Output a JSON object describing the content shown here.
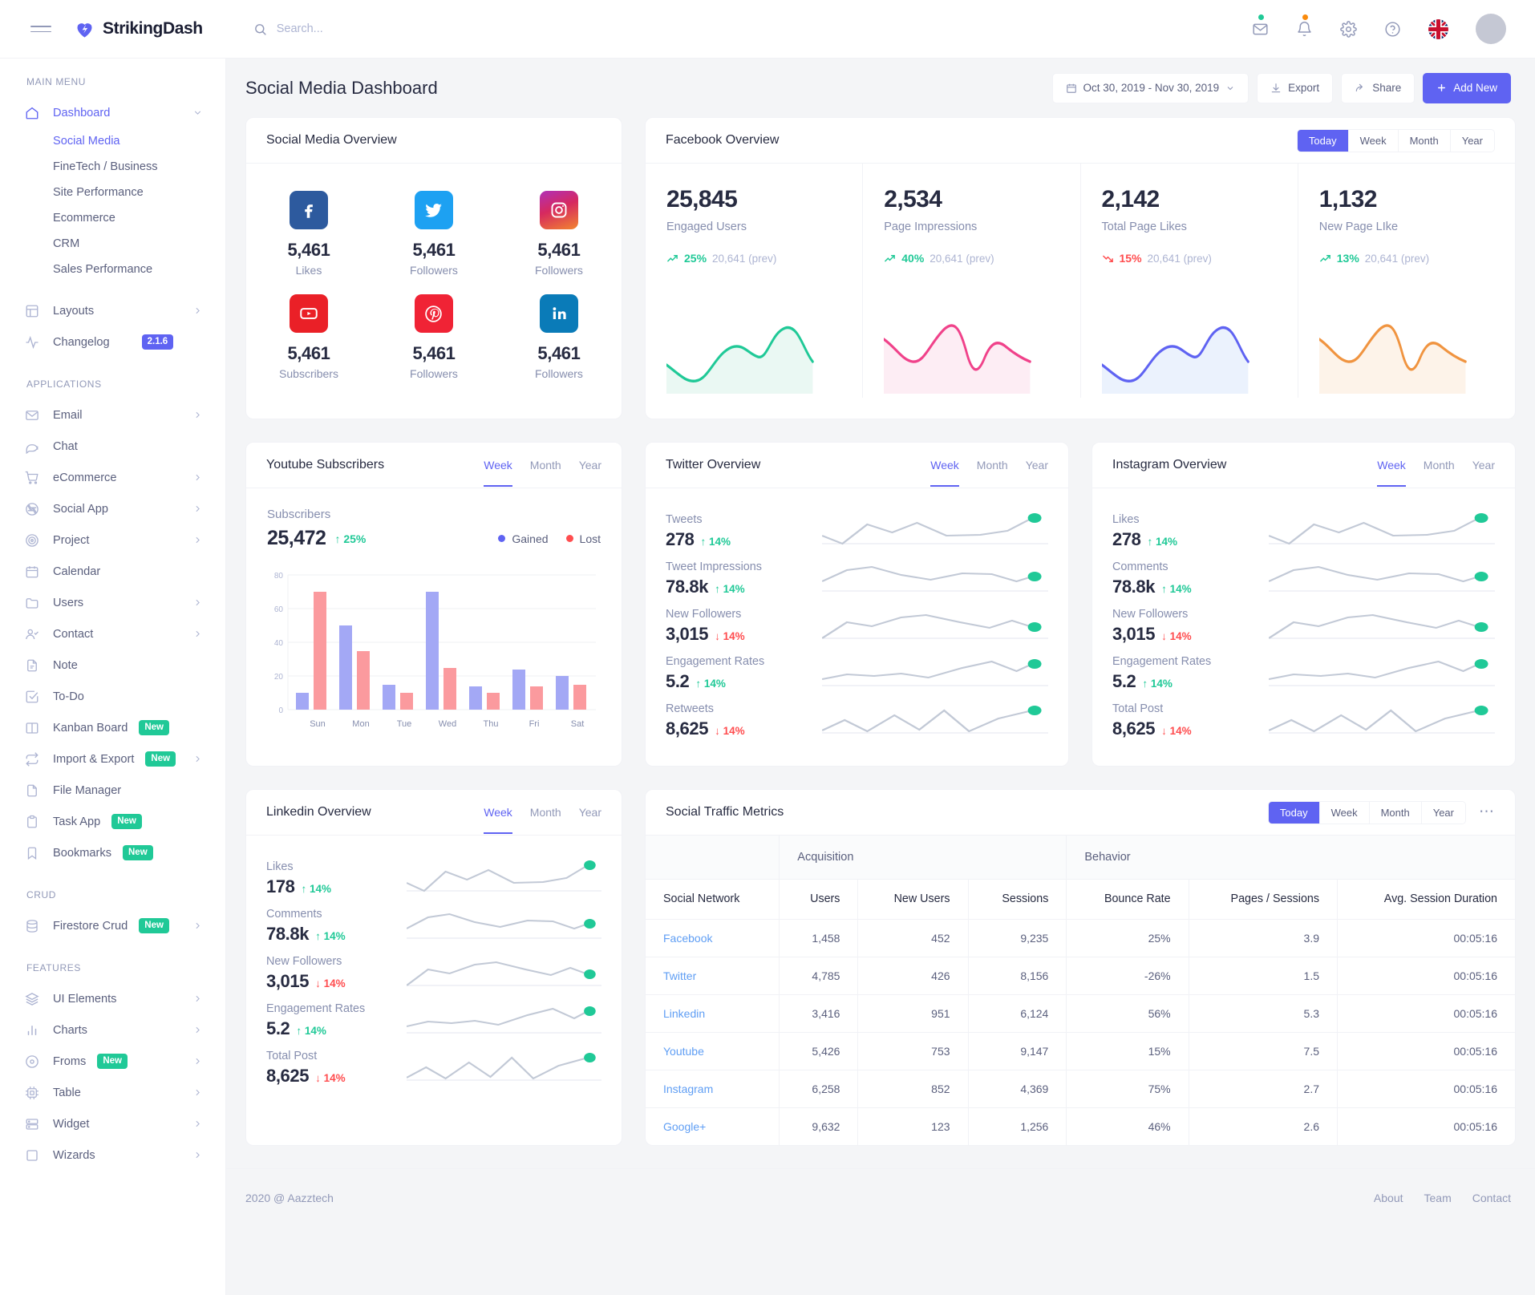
{
  "topbar": {
    "brand": "StrikingDash",
    "search_placeholder": "Search...",
    "icons": [
      "menu-icon",
      "mail-icon",
      "bell-icon",
      "gear-icon",
      "help-icon",
      "flag-uk-icon",
      "avatar"
    ]
  },
  "sidebar": {
    "groups": [
      {
        "label": "MAIN MENU",
        "items": [
          {
            "label": "Dashboard",
            "icon": "home-icon",
            "active": true,
            "caret": "down",
            "children": [
              {
                "label": "Social Media",
                "active": true
              },
              {
                "label": "FineTech / Business",
                "active": false
              },
              {
                "label": "Site Performance",
                "active": false
              },
              {
                "label": "Ecommerce",
                "active": false
              },
              {
                "label": "CRM",
                "active": false
              },
              {
                "label": "Sales Performance",
                "active": false
              }
            ]
          },
          {
            "label": "Layouts",
            "icon": "layout-icon",
            "caret": "right"
          },
          {
            "label": "Changelog",
            "icon": "activity-icon",
            "version": "2.1.6"
          }
        ]
      },
      {
        "label": "APPLICATIONS",
        "items": [
          {
            "label": "Email",
            "icon": "mail-icon",
            "caret": "right"
          },
          {
            "label": "Chat",
            "icon": "chat-icon"
          },
          {
            "label": "eCommerce",
            "icon": "cart-icon",
            "caret": "right"
          },
          {
            "label": "Social App",
            "icon": "aperture-icon",
            "caret": "right"
          },
          {
            "label": "Project",
            "icon": "target-icon",
            "caret": "right"
          },
          {
            "label": "Calendar",
            "icon": "calendar-icon"
          },
          {
            "label": "Users",
            "icon": "folder-icon",
            "caret": "right"
          },
          {
            "label": "Contact",
            "icon": "user-check-icon",
            "caret": "right"
          },
          {
            "label": "Note",
            "icon": "file-text-icon"
          },
          {
            "label": "To-Do",
            "icon": "check-square-icon"
          },
          {
            "label": "Kanban Board",
            "icon": "columns-icon",
            "badge": "New"
          },
          {
            "label": "Import & Export",
            "icon": "repeat-icon",
            "badge": "New",
            "caret": "right"
          },
          {
            "label": "File Manager",
            "icon": "file-icon"
          },
          {
            "label": "Task App",
            "icon": "clipboard-icon",
            "badge": "New"
          },
          {
            "label": "Bookmarks",
            "icon": "bookmark-icon",
            "badge": "New"
          }
        ]
      },
      {
        "label": "CRUD",
        "items": [
          {
            "label": "Firestore Crud",
            "icon": "database-icon",
            "badge": "New",
            "caret": "right"
          }
        ]
      },
      {
        "label": "FEATURES",
        "items": [
          {
            "label": "UI Elements",
            "icon": "layers-icon",
            "caret": "right"
          },
          {
            "label": "Charts",
            "icon": "bar-chart-icon",
            "caret": "right"
          },
          {
            "label": "Froms",
            "icon": "disc-icon",
            "badge": "New",
            "caret": "right"
          },
          {
            "label": "Table",
            "icon": "cpu-icon",
            "caret": "right"
          },
          {
            "label": "Widget",
            "icon": "server-icon",
            "caret": "right"
          },
          {
            "label": "Wizards",
            "icon": "square-icon",
            "caret": "right"
          }
        ]
      }
    ]
  },
  "page": {
    "title": "Social Media Dashboard",
    "date_range": "Oct 30, 2019 - Nov 30, 2019",
    "export_label": "Export",
    "share_label": "Share",
    "add_new_label": "Add New"
  },
  "social_overview": {
    "title": "Social Media Overview",
    "items": [
      {
        "network": "facebook",
        "value": "5,461",
        "label": "Likes"
      },
      {
        "network": "twitter",
        "value": "5,461",
        "label": "Followers"
      },
      {
        "network": "instagram",
        "value": "5,461",
        "label": "Followers"
      },
      {
        "network": "youtube",
        "value": "5,461",
        "label": "Subscribers"
      },
      {
        "network": "pinterest",
        "value": "5,461",
        "label": "Followers"
      },
      {
        "network": "linkedin",
        "value": "5,461",
        "label": "Followers"
      }
    ]
  },
  "facebook_overview": {
    "title": "Facebook Overview",
    "tabs": [
      "Today",
      "Week",
      "Month",
      "Year"
    ],
    "active_tab": "Today",
    "stats": [
      {
        "value": "25,845",
        "label": "Engaged Users",
        "pct": "25%",
        "dir": "up",
        "prev": "20,641 (prev)",
        "color": "#20c997"
      },
      {
        "value": "2,534",
        "label": "Page Impressions",
        "pct": "40%",
        "dir": "up",
        "prev": "20,641 (prev)",
        "color": "#f0428a"
      },
      {
        "value": "2,142",
        "label": "Total Page Likes",
        "pct": "15%",
        "dir": "down",
        "prev": "20,641 (prev)",
        "color": "#5f63f2"
      },
      {
        "value": "1,132",
        "label": "New Page LIke",
        "pct": "13%",
        "dir": "up",
        "prev": "20,641 (prev)",
        "color": "#f09440"
      }
    ]
  },
  "youtube": {
    "title": "Youtube Subscribers",
    "tabs": [
      "Week",
      "Month",
      "Year"
    ],
    "active_tab": "Week",
    "sub_label": "Subscribers",
    "sub_value": "25,472",
    "sub_delta": "25%",
    "legend": [
      {
        "label": "Gained",
        "color": "#5f63f2"
      },
      {
        "label": "Lost",
        "color": "#ff4d4f"
      }
    ]
  },
  "chart_data": {
    "type": "bar",
    "title": "Youtube Subscribers",
    "categories": [
      "Sun",
      "Mon",
      "Tue",
      "Wed",
      "Thu",
      "Fri",
      "Sat"
    ],
    "series": [
      {
        "name": "Gained",
        "color": "#a3a8f5",
        "values": [
          10,
          50,
          15,
          70,
          14,
          24,
          20
        ]
      },
      {
        "name": "Lost",
        "color": "#fb9a9e",
        "values": [
          70,
          35,
          10,
          25,
          10,
          14,
          15
        ]
      }
    ],
    "xlabel": "",
    "ylabel": "",
    "ylim": [
      0,
      80
    ],
    "yticks": [
      "0",
      "20",
      "40",
      "60",
      "80"
    ],
    "grid": true,
    "legend_position": "top-right"
  },
  "twitter": {
    "title": "Twitter Overview",
    "tabs": [
      "Week",
      "Month",
      "Year"
    ],
    "active_tab": "Week",
    "metrics": [
      {
        "label": "Tweets",
        "value": "278",
        "pct": "14%",
        "dir": "up"
      },
      {
        "label": "Tweet Impressions",
        "value": "78.8k",
        "pct": "14%",
        "dir": "up"
      },
      {
        "label": "New Followers",
        "value": "3,015",
        "pct": "14%",
        "dir": "down"
      },
      {
        "label": "Engagement Rates",
        "value": "5.2",
        "pct": "14%",
        "dir": "up"
      },
      {
        "label": "Retweets",
        "value": "8,625",
        "pct": "14%",
        "dir": "down"
      }
    ]
  },
  "instagram": {
    "title": "Instagram Overview",
    "tabs": [
      "Week",
      "Month",
      "Year"
    ],
    "active_tab": "Week",
    "metrics": [
      {
        "label": "Likes",
        "value": "278",
        "pct": "14%",
        "dir": "up"
      },
      {
        "label": "Comments",
        "value": "78.8k",
        "pct": "14%",
        "dir": "up"
      },
      {
        "label": "New Followers",
        "value": "3,015",
        "pct": "14%",
        "dir": "down"
      },
      {
        "label": "Engagement Rates",
        "value": "5.2",
        "pct": "14%",
        "dir": "up"
      },
      {
        "label": "Total Post",
        "value": "8,625",
        "pct": "14%",
        "dir": "down"
      }
    ]
  },
  "linkedin": {
    "title": "Linkedin Overview",
    "tabs": [
      "Week",
      "Month",
      "Year"
    ],
    "active_tab": "Week",
    "metrics": [
      {
        "label": "Likes",
        "value": "178",
        "pct": "14%",
        "dir": "up"
      },
      {
        "label": "Comments",
        "value": "78.8k",
        "pct": "14%",
        "dir": "up"
      },
      {
        "label": "New Followers",
        "value": "3,015",
        "pct": "14%",
        "dir": "down"
      },
      {
        "label": "Engagement Rates",
        "value": "5.2",
        "pct": "14%",
        "dir": "up"
      },
      {
        "label": "Total Post",
        "value": "8,625",
        "pct": "14%",
        "dir": "down"
      }
    ]
  },
  "traffic": {
    "title": "Social Traffic Metrics",
    "tabs": [
      "Today",
      "Week",
      "Month",
      "Year"
    ],
    "active_tab": "Today",
    "group_headers": [
      "",
      "Acquisition",
      "Behavior"
    ],
    "columns": [
      "Social Network",
      "Users",
      "New Users",
      "Sessions",
      "Bounce Rate",
      "Pages / Sessions",
      "Avg. Session Duration"
    ],
    "rows": [
      [
        "Facebook",
        "1,458",
        "452",
        "9,235",
        "25%",
        "3.9",
        "00:05:16"
      ],
      [
        "Twitter",
        "4,785",
        "426",
        "8,156",
        "-26%",
        "1.5",
        "00:05:16"
      ],
      [
        "Linkedin",
        "3,416",
        "951",
        "6,124",
        "56%",
        "5.3",
        "00:05:16"
      ],
      [
        "Youtube",
        "5,426",
        "753",
        "9,147",
        "15%",
        "7.5",
        "00:05:16"
      ],
      [
        "Instagram",
        "6,258",
        "852",
        "4,369",
        "75%",
        "2.7",
        "00:05:16"
      ],
      [
        "Google+",
        "9,632",
        "123",
        "1,256",
        "46%",
        "2.6",
        "00:05:16"
      ]
    ]
  },
  "footer": {
    "copyright": "2020 @ Aazztech",
    "links": [
      "About",
      "Team",
      "Contact"
    ]
  },
  "colors": {
    "primary": "#5f63f2",
    "success": "#20c997",
    "danger": "#ff4d4f",
    "pink": "#f0428a",
    "orange": "#f09440"
  }
}
